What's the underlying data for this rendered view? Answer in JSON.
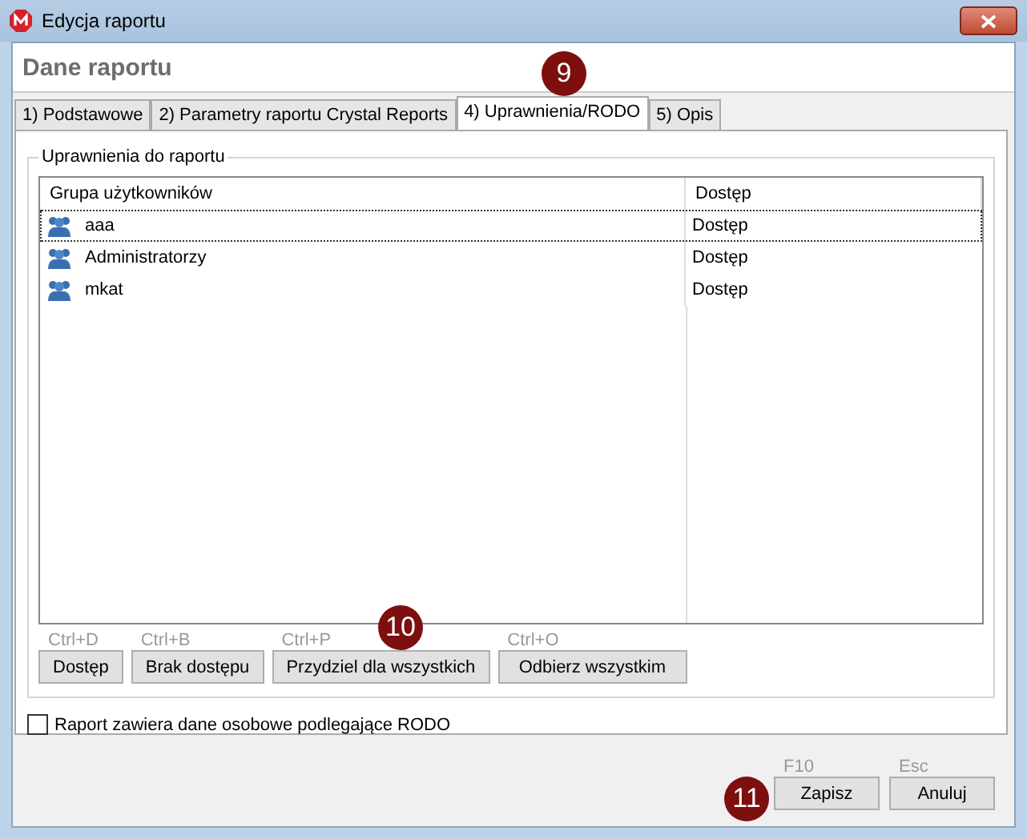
{
  "window": {
    "title": "Edycja raportu"
  },
  "header": "Dane raportu",
  "tabs": [
    {
      "label": "1) Podstawowe",
      "selected": false
    },
    {
      "label": "2) Parametry raportu Crystal Reports",
      "selected": false
    },
    {
      "label": "4) Uprawnienia/RODO",
      "selected": true
    },
    {
      "label": "5) Opis",
      "selected": false
    }
  ],
  "group": {
    "title": "Uprawnienia do raportu",
    "table": {
      "columns": [
        "Grupa użytkowników",
        "Dostęp"
      ],
      "rows": [
        {
          "name": "aaa",
          "access": "Dostęp",
          "selected": true
        },
        {
          "name": "Administratorzy",
          "access": "Dostęp",
          "selected": false
        },
        {
          "name": "mkat",
          "access": "Dostęp",
          "selected": false
        }
      ]
    },
    "buttons": [
      {
        "shortcut": "Ctrl+D",
        "label": "Dostęp"
      },
      {
        "shortcut": "Ctrl+B",
        "label": "Brak dostępu"
      },
      {
        "shortcut": "Ctrl+P",
        "label": "Przydziel dla wszystkich"
      },
      {
        "shortcut": "Ctrl+O",
        "label": "Odbierz wszystkim"
      }
    ]
  },
  "rodo_checkbox": {
    "label": "Raport zawiera dane osobowe podlegające RODO",
    "checked": false
  },
  "footer_buttons": [
    {
      "shortcut": "F10",
      "label": "Zapisz"
    },
    {
      "shortcut": "Esc",
      "label": "Anuluj"
    }
  ],
  "callouts": [
    {
      "number": "9"
    },
    {
      "number": "10"
    },
    {
      "number": "11"
    }
  ]
}
